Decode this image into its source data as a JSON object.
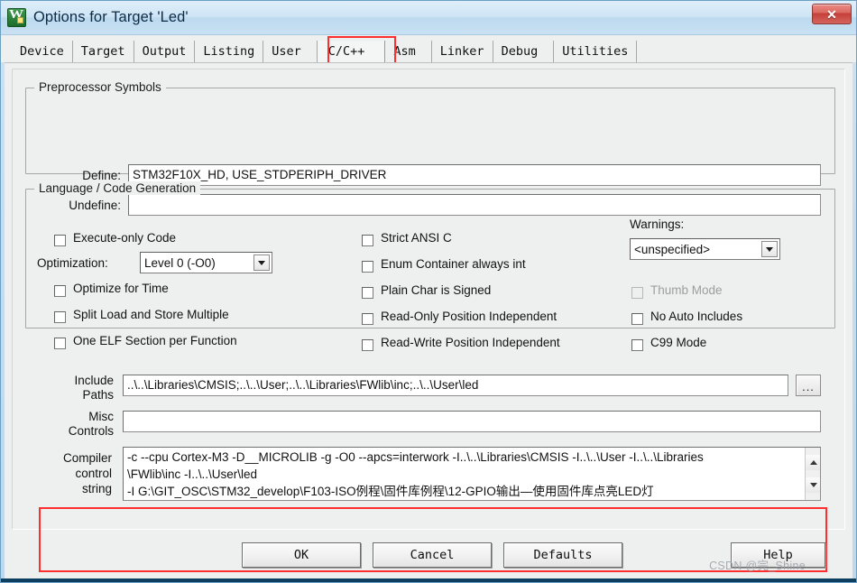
{
  "window": {
    "title": "Options for Target 'Led'",
    "app_icon": "keil-uvision-icon",
    "close_label": "✕"
  },
  "tabs": {
    "items": [
      {
        "label": "Device",
        "active": false
      },
      {
        "label": "Target",
        "active": false
      },
      {
        "label": "Output",
        "active": false
      },
      {
        "label": "Listing",
        "active": false
      },
      {
        "label": "User",
        "active": false
      },
      {
        "label": "C/C++",
        "active": true
      },
      {
        "label": "Asm",
        "active": false
      },
      {
        "label": "Linker",
        "active": false
      },
      {
        "label": "Debug",
        "active": false
      },
      {
        "label": "Utilities",
        "active": false
      }
    ],
    "highlight_color": "#ff2f2f"
  },
  "preprocessor": {
    "legend": "Preprocessor Symbols",
    "define_label": "Define:",
    "define_value": "STM32F10X_HD, USE_STDPERIPH_DRIVER",
    "undefine_label": "Undefine:",
    "undefine_value": ""
  },
  "language": {
    "legend": "Language / Code Generation",
    "left_checks": [
      {
        "label": "Execute-only Code",
        "checked": false,
        "disabled": false
      },
      {
        "label": "Optimize for Time",
        "checked": false,
        "disabled": false
      },
      {
        "label": "Split Load and Store Multiple",
        "checked": false,
        "disabled": false
      },
      {
        "label": "One ELF Section per Function",
        "checked": false,
        "disabled": false
      }
    ],
    "optimization_label": "Optimization:",
    "optimization_value": "Level 0 (-O0)",
    "middle_checks": [
      {
        "label": "Strict ANSI C",
        "checked": false,
        "disabled": false
      },
      {
        "label": "Enum Container always int",
        "checked": false,
        "disabled": false
      },
      {
        "label": "Plain Char is Signed",
        "checked": false,
        "disabled": false
      },
      {
        "label": "Read-Only Position Independent",
        "checked": false,
        "disabled": false
      },
      {
        "label": "Read-Write Position Independent",
        "checked": false,
        "disabled": false
      }
    ],
    "warnings_label": "Warnings:",
    "warnings_value": "<unspecified>",
    "right_checks": [
      {
        "label": "Thumb Mode",
        "checked": false,
        "disabled": true
      },
      {
        "label": "No Auto Includes",
        "checked": false,
        "disabled": false
      },
      {
        "label": "C99 Mode",
        "checked": false,
        "disabled": false
      }
    ]
  },
  "paths": {
    "include_label_line1": "Include",
    "include_label_line2": "Paths",
    "include_value": "..\\..\\Libraries\\CMSIS;..\\..\\User;..\\..\\Libraries\\FWlib\\inc;..\\..\\User\\led",
    "browse_label": "...",
    "misc_label_line1": "Misc",
    "misc_label_line2": "Controls",
    "misc_value": ""
  },
  "compiler": {
    "label_line1": "Compiler",
    "label_line2": "control",
    "label_line3": "string",
    "line1": "-c --cpu Cortex-M3 -D__MICROLIB -g -O0 --apcs=interwork -I..\\..\\Libraries\\CMSIS -I..\\..\\User -I..\\..\\Libraries",
    "line2": "\\FWlib\\inc -I..\\..\\User\\led",
    "line3": "-I G:\\GIT_OSC\\STM32_develop\\F103-ISO例程\\固件库例程\\12-GPIO输出—使用固件库点亮LED灯",
    "scroll_up_icon": "triangle-up-icon",
    "scroll_down_icon": "triangle-down-icon",
    "highlight_color": "#ff2f2f"
  },
  "buttons": {
    "ok": "OK",
    "cancel": "Cancel",
    "defaults": "Defaults",
    "help": "Help"
  },
  "watermark": "CSDN @完_Shine"
}
